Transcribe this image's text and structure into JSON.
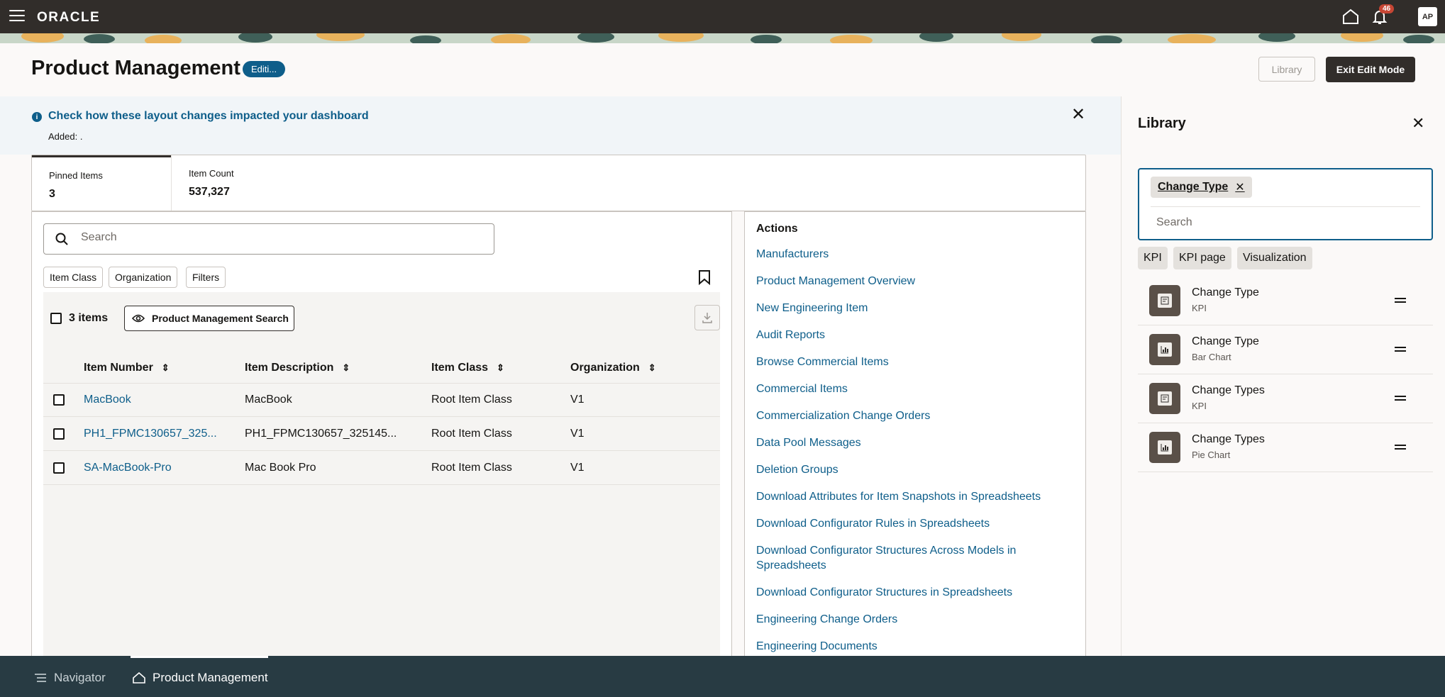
{
  "topbar": {
    "logo": "ORACLE",
    "notification_count": "46",
    "avatar_initials": "AP"
  },
  "header": {
    "title": "Product Management",
    "edit_badge": "Editi...",
    "library_button": "Library",
    "exit_button": "Exit Edit Mode"
  },
  "notice": {
    "title": "Check how these layout changes impacted your dashboard",
    "subtitle": "Added: ."
  },
  "stats": [
    {
      "label": "Pinned Items",
      "value": "3"
    },
    {
      "label": "Item Count",
      "value": "537,327"
    }
  ],
  "items": {
    "search_placeholder": "Search",
    "filter_chips": [
      "Item Class",
      "Organization",
      "Filters"
    ],
    "count_label": "3 items",
    "search_button": "Product Management Search",
    "columns": [
      "Item Number",
      "Item Description",
      "Item Class",
      "Organization"
    ],
    "rows": [
      {
        "number": "MacBook",
        "description": "MacBook",
        "class": "Root Item Class",
        "org": "V1"
      },
      {
        "number": "PH1_FPMC130657_325...",
        "description": "PH1_FPMC130657_325145...",
        "class": "Root Item Class",
        "org": "V1"
      },
      {
        "number": "SA-MacBook-Pro",
        "description": "Mac Book Pro",
        "class": "Root Item Class",
        "org": "V1"
      }
    ]
  },
  "actions": {
    "title": "Actions",
    "links": [
      "Manufacturers",
      "Product Management Overview",
      "New Engineering Item",
      "Audit Reports",
      "Browse Commercial Items",
      "Commercial Items",
      "Commercialization Change Orders",
      "Data Pool Messages",
      "Deletion Groups",
      "Download Attributes for Item Snapshots in Spreadsheets",
      "Download Configurator Rules in Spreadsheets",
      "Download Configurator Structures Across Models in Spreadsheets",
      "Download Configurator Structures in Spreadsheets",
      "Engineering Change Orders",
      "Engineering Documents"
    ]
  },
  "library": {
    "title": "Library",
    "filter_tag": "Change Type",
    "search_placeholder": "Search",
    "chips": [
      "KPI",
      "KPI page",
      "Visualization"
    ],
    "items": [
      {
        "name": "Change Type",
        "type": "KPI",
        "icon": "kpi-icon"
      },
      {
        "name": "Change Type",
        "type": "Bar Chart",
        "icon": "chart-icon"
      },
      {
        "name": "Change Types",
        "type": "KPI",
        "icon": "kpi-icon"
      },
      {
        "name": "Change Types",
        "type": "Pie Chart",
        "icon": "chart-icon"
      }
    ]
  },
  "bottombar": {
    "navigator": "Navigator",
    "current": "Product Management"
  },
  "colors": {
    "topbar": "#312d2a",
    "link": "#0e5e8a",
    "bottombar": "#283b43",
    "badge": "#c74634"
  }
}
